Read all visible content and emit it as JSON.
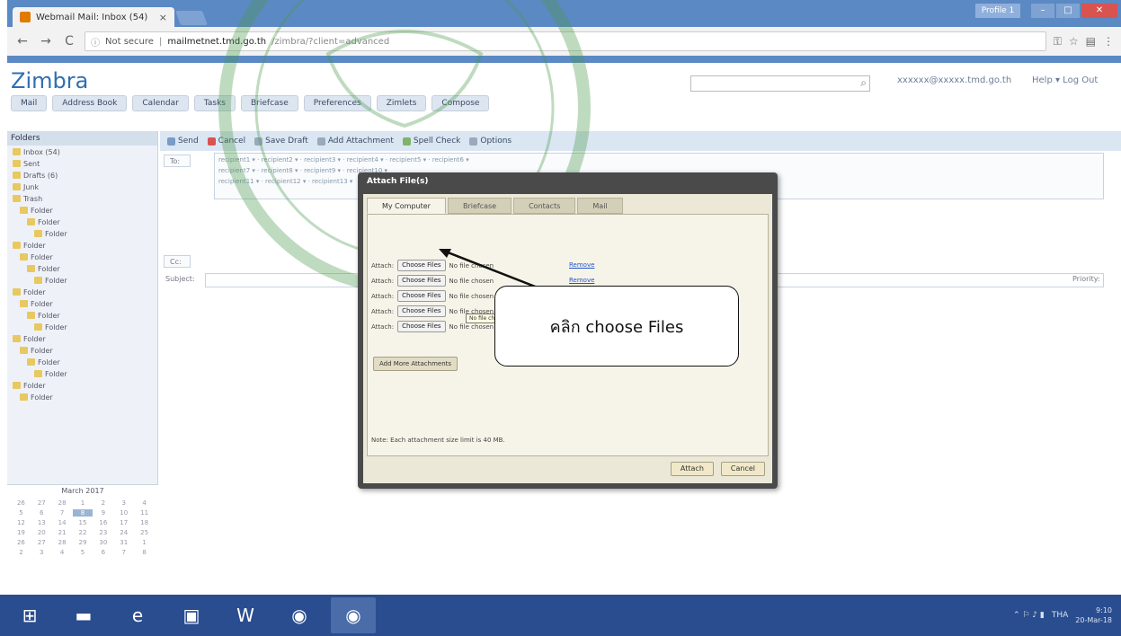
{
  "browser": {
    "tab_title": "Webmail Mail: Inbox (54)",
    "tab_close": "×",
    "security_label": "Not secure",
    "url_host": "mailmetnet.tmd.go.th",
    "url_path": "/zimbra/?client=advanced",
    "window_user": "Profile 1"
  },
  "app": {
    "logo": "Zimbra",
    "nav_tabs": [
      "Mail",
      "Address Book",
      "Calendar",
      "Tasks",
      "Briefcase",
      "Preferences",
      "Zimlets",
      "Compose"
    ]
  },
  "sidebar": {
    "header": "Folders",
    "folders": [
      "Inbox (54)",
      "Sent",
      "Drafts (6)",
      "Junk",
      "Trash",
      "Folder",
      "Folder",
      "Folder",
      "Folder",
      "Folder",
      "Folder",
      "Folder",
      "Folder",
      "Folder",
      "Folder",
      "Folder",
      "Folder",
      "Folder",
      "Folder",
      "Folder",
      "Folder",
      "Folder"
    ],
    "calendar_title": "March 2017",
    "calendar_days": [
      "26",
      "27",
      "28",
      "1",
      "2",
      "3",
      "4",
      "5",
      "6",
      "7",
      "8",
      "9",
      "10",
      "11",
      "12",
      "13",
      "14",
      "15",
      "16",
      "17",
      "18",
      "19",
      "20",
      "21",
      "22",
      "23",
      "24",
      "25",
      "26",
      "27",
      "28",
      "29",
      "30",
      "31",
      "1",
      "2",
      "3",
      "4",
      "5",
      "6",
      "7",
      "8"
    ],
    "calendar_today_index": 10
  },
  "compose": {
    "toolbar": [
      "Send",
      "Cancel",
      "Save Draft",
      "Add Attachment",
      "Spell Check",
      "Options"
    ],
    "to_label": "To:",
    "cc_label": "Cc:",
    "subject_label": "Subject:",
    "priority_label": "Priority:",
    "subject_value": "",
    "body_text": ""
  },
  "dialog": {
    "title": "Attach File(s)",
    "tabs": [
      "My Computer",
      "Briefcase",
      "Contacts",
      "Mail"
    ],
    "attach_label": "Attach:",
    "choose_label": "Choose Files",
    "no_file_label": "No file chosen",
    "remove_label": "Remove",
    "tooltip": "No file chosen",
    "add_more": "Add More Attachments",
    "note": "Note: Each attachment size limit is 40 MB.",
    "attach_btn": "Attach",
    "cancel_btn": "Cancel"
  },
  "callout": {
    "text": "คลิก choose Files"
  },
  "taskbar": {
    "items": [
      "start-icon",
      "file-explorer-icon",
      "internet-explorer-icon",
      "photo-icon",
      "word-icon",
      "chrome-icon",
      "chrome-icon"
    ],
    "lang": "THA",
    "time": "9:10",
    "date": "20-Mar-18"
  }
}
